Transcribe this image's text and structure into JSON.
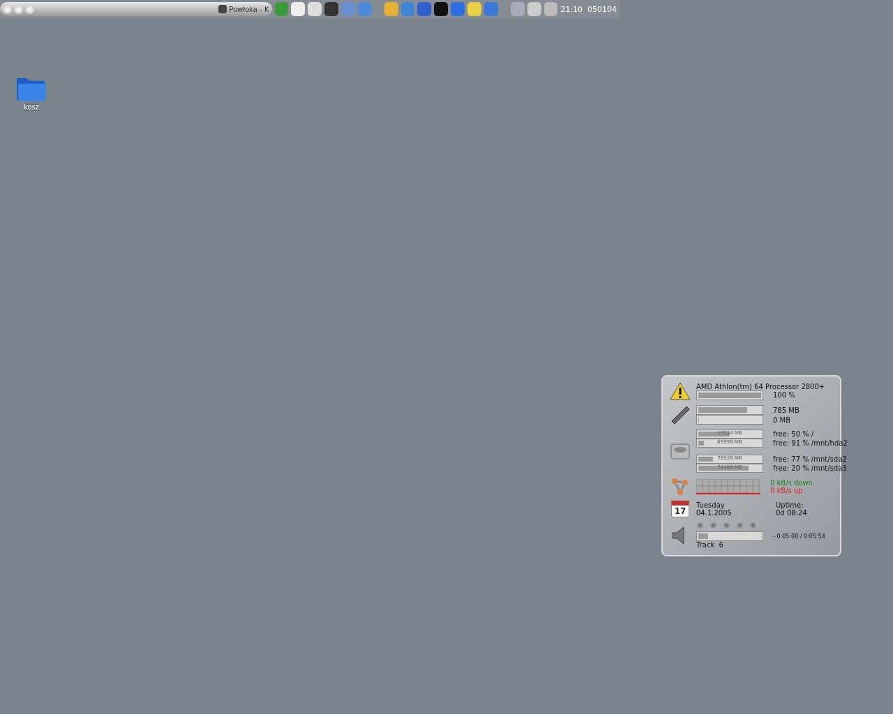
{
  "taskbar": {
    "task": {
      "title": "Powłoka - K"
    },
    "clock": "21:10  050104"
  },
  "desktop_icons": [
    {
      "label": "kosz"
    }
  ],
  "monitor": {
    "cpu": {
      "name": "AMD Athlon(tm) 64 Processor 2800+",
      "level": 1.0,
      "reading": "100 %"
    },
    "memory": [
      {
        "level": 0.78,
        "reading": "785 MB"
      },
      {
        "level": 0,
        "reading": "0 MB"
      }
    ],
    "disks": [
      {
        "level": 0.5,
        "size": "10314 MB",
        "reading": "free: 50 % /"
      },
      {
        "level": 0.09,
        "size": "65999 MB",
        "reading": "free: 91 % /mnt/hda2"
      },
      {
        "level": 0.23,
        "size": "76526 MB",
        "reading": "free: 77 % /mnt/sda2"
      },
      {
        "level": 0.8,
        "size": "74180 MB",
        "reading": "free: 20 % /mnt/sda3"
      }
    ],
    "network": {
      "down": "0 kB/s down",
      "up": "0 kB/s up"
    },
    "date": {
      "icon_day": "17",
      "day": "Tuesday",
      "date": "04.1.2005"
    },
    "uptime": {
      "label": "Uptime:",
      "value": "0d 08:24"
    },
    "player": {
      "level": 0.15,
      "time": "- 0:05:00 / 0:05:54",
      "track": "Track  6"
    }
  }
}
